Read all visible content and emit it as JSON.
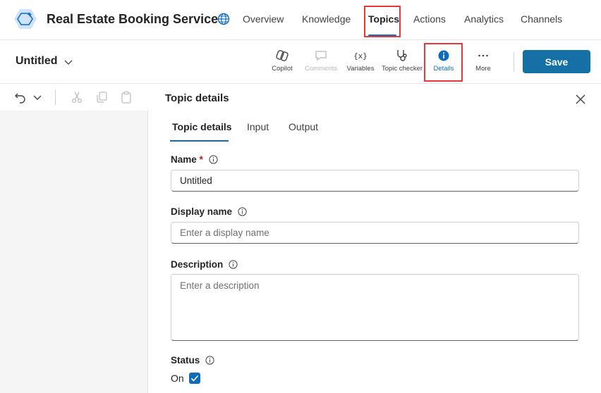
{
  "app": {
    "title": "Real Estate Booking Service",
    "accent": "#0f6cbd"
  },
  "nav": {
    "tabs": [
      {
        "label": "Overview"
      },
      {
        "label": "Knowledge"
      },
      {
        "label": "Topics",
        "active": true
      },
      {
        "label": "Actions"
      },
      {
        "label": "Analytics"
      },
      {
        "label": "Channels"
      }
    ]
  },
  "toolbar": {
    "doc_title": "Untitled",
    "tools": [
      {
        "label": "Copilot",
        "icon": "copilot-icon"
      },
      {
        "label": "Comments",
        "icon": "comment-icon",
        "disabled": true
      },
      {
        "label": "Variables",
        "icon": "variables-icon"
      },
      {
        "label": "Topic checker",
        "icon": "stethoscope-icon"
      },
      {
        "label": "Details",
        "icon": "info-icon",
        "active": true
      },
      {
        "label": "More",
        "icon": "more-icon"
      }
    ],
    "save_label": "Save"
  },
  "panel": {
    "title": "Topic details",
    "tabs": [
      {
        "label": "Topic details",
        "active": true
      },
      {
        "label": "Input"
      },
      {
        "label": "Output"
      }
    ],
    "fields": {
      "name": {
        "label": "Name",
        "required_mark": "*",
        "value": "Untitled"
      },
      "display_name": {
        "label": "Display name",
        "placeholder": "Enter a display name"
      },
      "description": {
        "label": "Description",
        "placeholder": "Enter a description"
      },
      "status": {
        "label": "Status",
        "value": "On",
        "checked": true
      }
    }
  }
}
